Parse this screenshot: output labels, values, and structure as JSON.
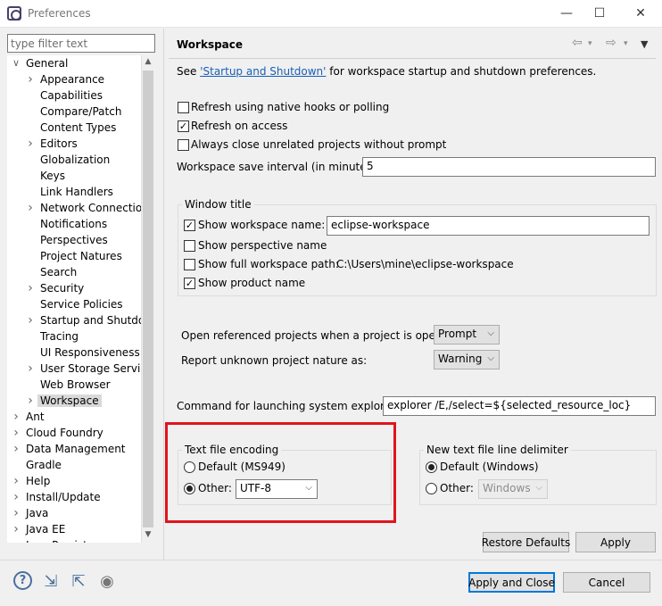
{
  "window": {
    "title": "Preferences",
    "minimize": "—",
    "maximize": "☐",
    "close": "✕"
  },
  "filter": {
    "placeholder": "type filter text",
    "value": ""
  },
  "tree": [
    {
      "label": "General",
      "level": 0,
      "expanded": true,
      "twisty": true
    },
    {
      "label": "Appearance",
      "level": 1,
      "twisty": true
    },
    {
      "label": "Capabilities",
      "level": 1
    },
    {
      "label": "Compare/Patch",
      "level": 1
    },
    {
      "label": "Content Types",
      "level": 1
    },
    {
      "label": "Editors",
      "level": 1,
      "twisty": true
    },
    {
      "label": "Globalization",
      "level": 1
    },
    {
      "label": "Keys",
      "level": 1
    },
    {
      "label": "Link Handlers",
      "level": 1
    },
    {
      "label": "Network Connections",
      "level": 1,
      "twisty": true
    },
    {
      "label": "Notifications",
      "level": 1
    },
    {
      "label": "Perspectives",
      "level": 1
    },
    {
      "label": "Project Natures",
      "level": 1
    },
    {
      "label": "Search",
      "level": 1
    },
    {
      "label": "Security",
      "level": 1,
      "twisty": true
    },
    {
      "label": "Service Policies",
      "level": 1
    },
    {
      "label": "Startup and Shutdown",
      "level": 1,
      "twisty": true
    },
    {
      "label": "Tracing",
      "level": 1
    },
    {
      "label": "UI Responsiveness Monitoring",
      "level": 1
    },
    {
      "label": "User Storage Service",
      "level": 1,
      "twisty": true
    },
    {
      "label": "Web Browser",
      "level": 1
    },
    {
      "label": "Workspace",
      "level": 1,
      "twisty": true,
      "selected": true
    },
    {
      "label": "Ant",
      "level": 0,
      "twisty": true
    },
    {
      "label": "Cloud Foundry",
      "level": 0,
      "twisty": true
    },
    {
      "label": "Data Management",
      "level": 0,
      "twisty": true
    },
    {
      "label": "Gradle",
      "level": 0
    },
    {
      "label": "Help",
      "level": 0,
      "twisty": true
    },
    {
      "label": "Install/Update",
      "level": 0,
      "twisty": true
    },
    {
      "label": "Java",
      "level": 0,
      "twisty": true
    },
    {
      "label": "Java EE",
      "level": 0,
      "twisty": true
    },
    {
      "label": "Java Persistence",
      "level": 0,
      "twisty": true
    }
  ],
  "page": {
    "title": "Workspace",
    "see_prefix": "See ",
    "see_link": "'Startup and Shutdown'",
    "see_suffix": " for workspace startup and shutdown preferences.",
    "refresh_native": {
      "label": "Refresh using native hooks or polling",
      "checked": false
    },
    "refresh_access": {
      "label": "Refresh on access",
      "checked": true
    },
    "always_close": {
      "label": "Always close unrelated projects without prompt",
      "checked": false
    },
    "save_interval": {
      "label": "Workspace save interval (in minutes):",
      "value": "5"
    },
    "window_title": {
      "group_label": "Window title",
      "show_ws_name": {
        "label": "Show workspace name:",
        "checked": true,
        "value": "eclipse-workspace"
      },
      "show_perspective": {
        "label": "Show perspective name",
        "checked": false
      },
      "show_full_path": {
        "label": "Show full workspace path:",
        "checked": false,
        "value": "C:\\Users\\mine\\eclipse-workspace"
      },
      "show_product": {
        "label": "Show product name",
        "checked": true
      }
    },
    "open_ref": {
      "label": "Open referenced projects when a project is opened:",
      "value": "Prompt"
    },
    "report_nature": {
      "label": "Report unknown project nature as:",
      "value": "Warning"
    },
    "cmd_explorer": {
      "label": "Command for launching system explorer:",
      "value": "explorer /E,/select=${selected_resource_loc}"
    },
    "encoding": {
      "group_label": "Text file encoding",
      "default_label": "Default (MS949)",
      "other_label": "Other:",
      "other_value": "UTF-8",
      "selected": "other"
    },
    "line_delim": {
      "group_label": "New text file line delimiter",
      "default_label": "Default (Windows)",
      "other_label": "Other:",
      "other_value": "Windows",
      "selected": "default"
    },
    "restore_defaults": "Restore Defaults",
    "apply": "Apply"
  },
  "footer": {
    "apply_close": "Apply and Close",
    "cancel": "Cancel"
  },
  "colors": {
    "highlight": "#e0141e",
    "link": "#1a5fb4",
    "default_button": "#0078d7"
  }
}
